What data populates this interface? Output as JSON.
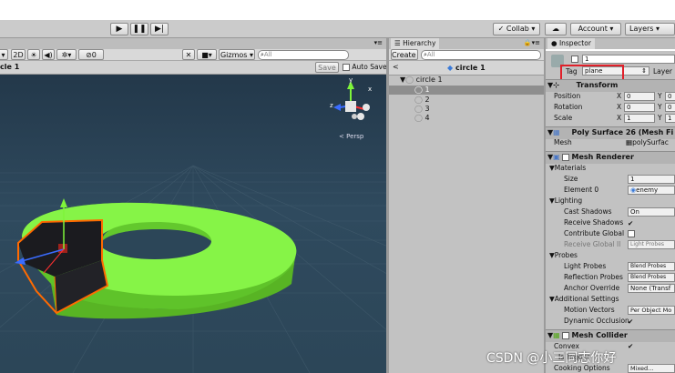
{
  "toolbar": {
    "play": "▶",
    "pause": "❚❚",
    "step": "▶|",
    "collab": "Collab",
    "account": "Account",
    "layers": "Layers"
  },
  "scene_panel": {
    "mode_2d": "2D",
    "gizmos": "Gizmos",
    "search_placeholder": "All",
    "scene_title": "cle 1",
    "save": "Save",
    "auto_save": "Auto Save",
    "persp": "Persp",
    "fx_count": "0",
    "axis_y": "y",
    "axis_x": "x",
    "axis_z": "z"
  },
  "hierarchy": {
    "tab": "Hierarchy",
    "create": "Create",
    "search_placeholder": "All",
    "scene_name": "circle 1",
    "items": [
      {
        "label": "circle 1"
      },
      {
        "label": "1"
      },
      {
        "label": "2"
      },
      {
        "label": "3"
      },
      {
        "label": "4"
      }
    ]
  },
  "inspector": {
    "tab": "Inspector",
    "object_name": "1",
    "tag_label": "Tag",
    "tag_value": "plane",
    "layer_label": "Layer",
    "transform_header": "Transform",
    "position_label": "Position",
    "position": {
      "x": "0",
      "y": "0"
    },
    "rotation_label": "Rotation",
    "rotation": {
      "x": "0",
      "y": "0"
    },
    "scale_label": "Scale",
    "scale": {
      "x": "1",
      "y": "1"
    },
    "x_label": "X",
    "y_label": "Y",
    "mesh_filter_header": "Poly Surface 26 (Mesh Fi",
    "mesh_label": "Mesh",
    "mesh_value": "polySurfac",
    "mesh_renderer_header": "Mesh Renderer",
    "materials_label": "Materials",
    "size_label": "Size",
    "size_value": "1",
    "element0_label": "Element 0",
    "element0_value": "enemy",
    "lighting_label": "Lighting",
    "cast_shadows_label": "Cast Shadows",
    "cast_shadows_value": "On",
    "receive_shadows_label": "Receive Shadows",
    "contribute_gi_label": "Contribute Global",
    "receive_gi_label": "Receive Global Il",
    "receive_gi_value": "Light Probes",
    "probes_label": "Probes",
    "light_probes_label": "Light Probes",
    "light_probes_value": "Blend Probes",
    "reflection_probes_label": "Reflection Probes",
    "reflection_probes_value": "Blend Probes",
    "anchor_override_label": "Anchor Override",
    "anchor_override_value": "None (Transf",
    "additional_settings_label": "Additional Settings",
    "motion_vectors_label": "Motion Vectors",
    "motion_vectors_value": "Per Object Mo",
    "dynamic_occlusion_label": "Dynamic Occlusion",
    "mesh_collider_header": "Mesh Collider",
    "convex_label": "Convex",
    "is_trigger_label": "Is Trigger",
    "cooking_options_label": "Cooking Options",
    "cooking_options_value": "Mixed..."
  },
  "watermark": "CSDN @小三同志你好",
  "colors": {
    "ring_green": "#7ef53a",
    "selection_orange": "#ff6a00",
    "scene_bg": "#2e4657",
    "highlight_red": "#e0202a"
  }
}
